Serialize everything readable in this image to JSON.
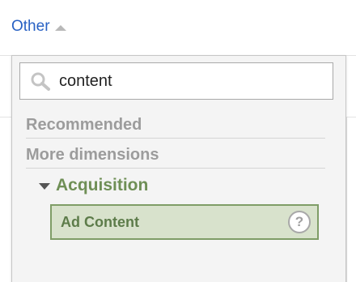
{
  "header": {
    "toggle_label": "Other",
    "toggle_icon": "caret-up-icon"
  },
  "dropdown": {
    "search": {
      "value": "content",
      "icon": "search-icon"
    },
    "sections": [
      {
        "label": "Recommended"
      },
      {
        "label": "More dimensions"
      }
    ],
    "group": {
      "label": "Acquisition",
      "expanded": true
    },
    "results": [
      {
        "label": "Ad Content",
        "highlighted": true,
        "help_icon": "?"
      }
    ]
  },
  "colors": {
    "link": "#2962c4",
    "group_green": "#6f8f56",
    "highlight_bg": "#d8e2cc",
    "highlight_border": "#7f9d67",
    "muted_header": "#9c9c9c"
  }
}
